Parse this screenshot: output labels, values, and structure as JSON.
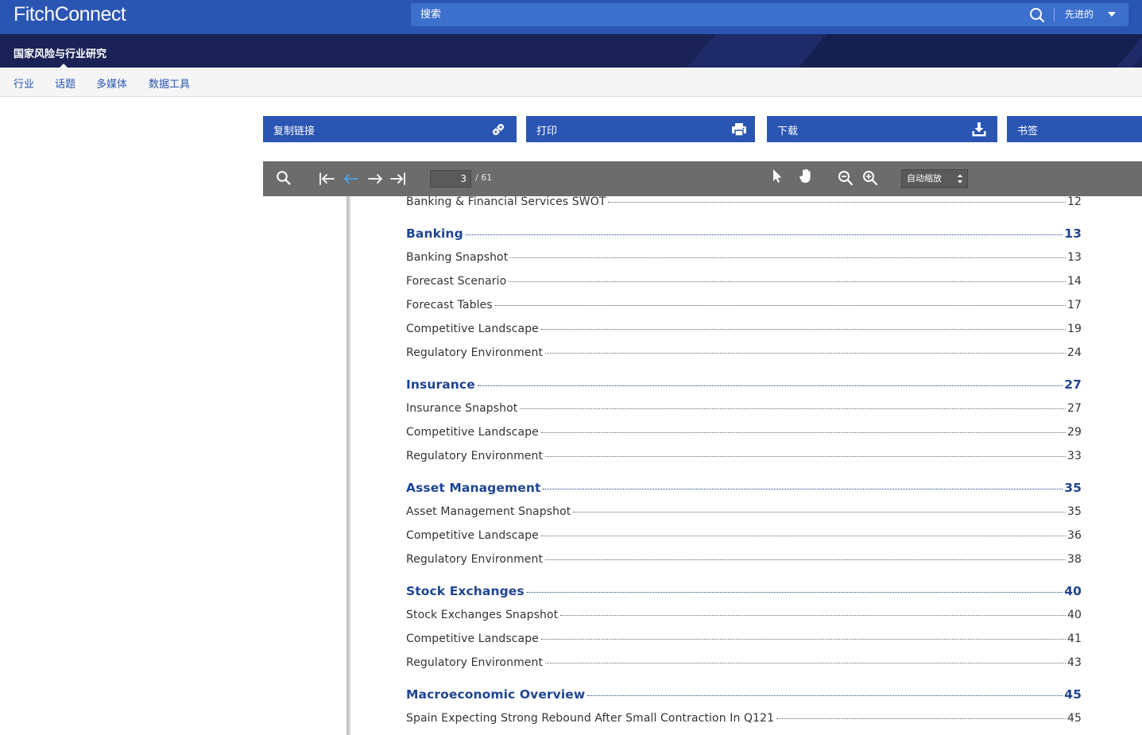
{
  "header": {
    "logo_part1": "Fitch",
    "logo_part2": "Connect",
    "search_placeholder": "搜索",
    "advanced_label": "先进的"
  },
  "section": {
    "title": "国家风险与行业研究"
  },
  "tabs": [
    {
      "label": "行业"
    },
    {
      "label": "话题"
    },
    {
      "label": "多媒体"
    },
    {
      "label": "数据工具"
    }
  ],
  "actions": [
    {
      "label": "复制链接",
      "icon": "link-icon"
    },
    {
      "label": "打印",
      "icon": "printer-icon"
    },
    {
      "label": "下载",
      "icon": "download-icon"
    },
    {
      "label": "书签",
      "icon": "bookmark-icon"
    }
  ],
  "pdf_toolbar": {
    "current_page": "3",
    "page_count": "/ 61",
    "zoom": "自动缩放"
  },
  "toc": [
    {
      "title": "Banking & Financial Services SWOT",
      "page": "12",
      "heading": false
    },
    {
      "title": "Banking",
      "page": "13",
      "heading": true
    },
    {
      "title": "Banking Snapshot",
      "page": "13",
      "heading": false
    },
    {
      "title": "Forecast Scenario",
      "page": "14",
      "heading": false
    },
    {
      "title": "Forecast Tables",
      "page": "17",
      "heading": false
    },
    {
      "title": "Competitive Landscape",
      "page": "19",
      "heading": false
    },
    {
      "title": "Regulatory Environment",
      "page": "24",
      "heading": false
    },
    {
      "title": "Insurance",
      "page": "27",
      "heading": true
    },
    {
      "title": "Insurance Snapshot",
      "page": "27",
      "heading": false
    },
    {
      "title": "Competitive Landscape",
      "page": "29",
      "heading": false
    },
    {
      "title": "Regulatory Environment",
      "page": "33",
      "heading": false
    },
    {
      "title": "Asset Management",
      "page": "35",
      "heading": true
    },
    {
      "title": "Asset Management Snapshot",
      "page": "35",
      "heading": false
    },
    {
      "title": "Competitive Landscape",
      "page": "36",
      "heading": false
    },
    {
      "title": "Regulatory Environment",
      "page": "38",
      "heading": false
    },
    {
      "title": "Stock Exchanges",
      "page": "40",
      "heading": true
    },
    {
      "title": "Stock Exchanges Snapshot",
      "page": "40",
      "heading": false
    },
    {
      "title": "Competitive Landscape",
      "page": "41",
      "heading": false
    },
    {
      "title": "Regulatory Environment",
      "page": "43",
      "heading": false
    },
    {
      "title": "Macroeconomic Overview",
      "page": "45",
      "heading": true
    },
    {
      "title": "Spain Expecting Strong Rebound After Small Contraction In Q121",
      "page": "45",
      "heading": false
    }
  ],
  "colors": {
    "brand_blue": "#2a55b3",
    "section_navy": "#1a2256",
    "toc_heading": "#1f4591",
    "toolbar_gray": "#6c6c6c",
    "active_nav_arrow": "#4aa3e8"
  }
}
